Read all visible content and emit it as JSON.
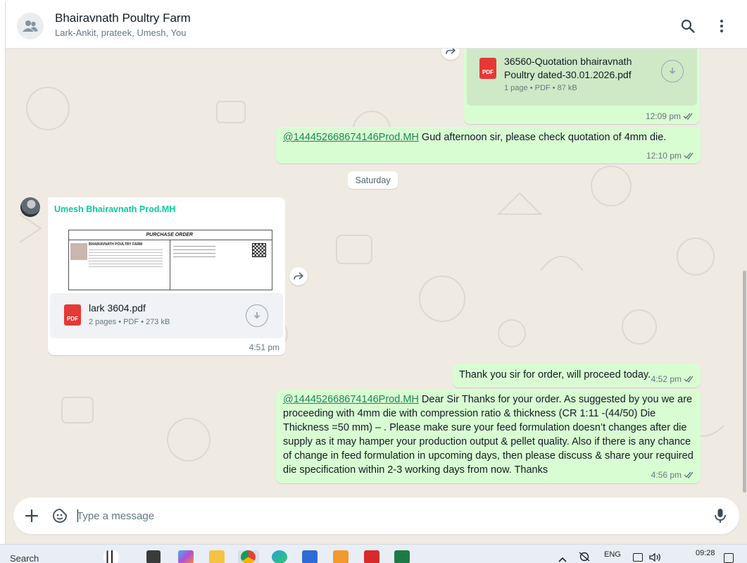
{
  "header": {
    "title": "Bhairavnath Poultry Farm",
    "subtitle": "Lark-Ankit, prateek, Umesh, You"
  },
  "messages": {
    "quotation_doc": {
      "name_line1": "36560-Quotation bhairavnath",
      "name_line2": "Poultry dated-30.01.2026.pdf",
      "meta": "1 page • PDF • 87 kB",
      "time": "12:09 pm",
      "pdf_badge": "PDF"
    },
    "afternoon_msg": {
      "mention": "@144452668674146Prod.MH",
      "text": " Gud afternoon sir, please check quotation of 4mm die.",
      "time": "12:10 pm"
    },
    "day_separator": "Saturday",
    "po_doc": {
      "sender": "Umesh Bhairavnath Prod.MH",
      "preview_title": "PURCHASE ORDER",
      "preview_company": "BHAIRAVNATH POULTRY FARM",
      "file_name": "lark 3604.pdf",
      "meta": "2 pages • PDF • 273 kB",
      "time": "4:51 pm",
      "pdf_badge": "PDF"
    },
    "thanks_msg": {
      "text": "Thank you sir for order, will proceed today.",
      "time": "4:52 pm"
    },
    "long_msg": {
      "mention": "@144452668674146Prod.MH",
      "line1": " Dear Sir Thanks for your order. As suggested by you we are",
      "line2": "proceeding with  4mm die with compression ratio & thickness (CR 1:11 -(44/50) Die",
      "line3": "Thickness =50 mm) – . Please make sure your feed formulation doesn’t changes after die",
      "line4": "supply as it may hamper your production output & pellet quality. Also if there is any chance",
      "line5": "of change in feed formulation in upcoming days, then please discuss & share your required",
      "line6": "die specification within 2-3 working days from now. Thanks",
      "time": "4:56 pm"
    }
  },
  "composer": {
    "placeholder": "Type a message"
  },
  "taskbar": {
    "search_label": "Search",
    "language": "ENG",
    "clock": "09:28"
  },
  "colors": {
    "outgoing_bubble": "#d9fdd3",
    "incoming_bubble": "#ffffff",
    "sender_name": "#06cf9c",
    "pdf_red": "#e53935",
    "chat_background": "#efeae2"
  },
  "icons": [
    "group-avatar-icon",
    "search-icon",
    "menu-icon",
    "pdf-icon",
    "download-icon",
    "forward-icon",
    "double-check-icon",
    "plus-icon",
    "sticker-icon",
    "mic-icon"
  ]
}
